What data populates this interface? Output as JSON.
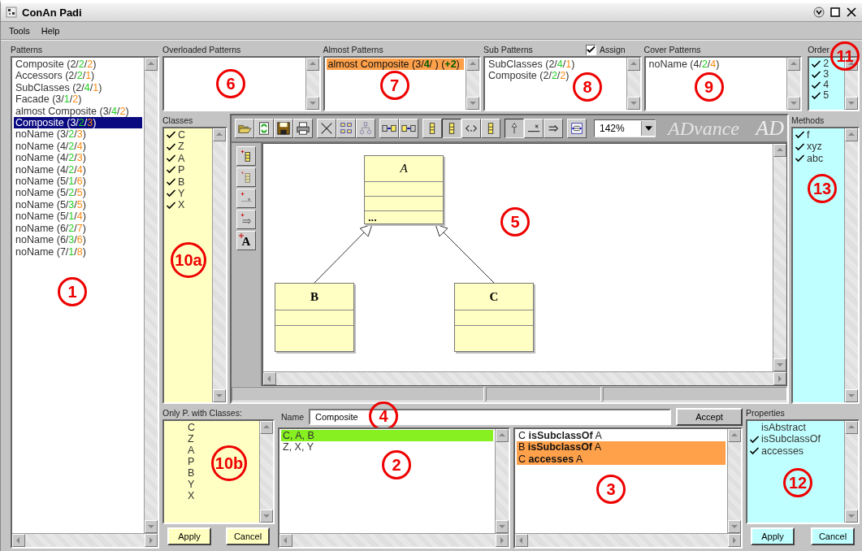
{
  "window": {
    "title": "ConAn Padi"
  },
  "menu": [
    {
      "label": "Tools"
    },
    {
      "label": "Help"
    }
  ],
  "patterns": {
    "label": "Patterns",
    "callout": "1",
    "items": [
      {
        "selected": false,
        "segments": [
          {
            "text": "Composite (2/",
            "kind": "plain"
          },
          {
            "text": "2",
            "kind": "match"
          },
          {
            "text": "/",
            "kind": "plain"
          },
          {
            "text": "2",
            "kind": "extra"
          },
          {
            "text": ")",
            "kind": "plain"
          }
        ]
      },
      {
        "selected": false,
        "segments": [
          {
            "text": "Accessors (2/",
            "kind": "plain"
          },
          {
            "text": "2",
            "kind": "match"
          },
          {
            "text": "/",
            "kind": "plain"
          },
          {
            "text": "1",
            "kind": "extra"
          },
          {
            "text": ")",
            "kind": "plain"
          }
        ]
      },
      {
        "selected": false,
        "segments": [
          {
            "text": "SubClasses (2/",
            "kind": "plain"
          },
          {
            "text": "4",
            "kind": "match"
          },
          {
            "text": "/",
            "kind": "plain"
          },
          {
            "text": "1",
            "kind": "extra"
          },
          {
            "text": ")",
            "kind": "plain"
          }
        ]
      },
      {
        "selected": false,
        "segments": [
          {
            "text": "Facade (3/",
            "kind": "plain"
          },
          {
            "text": "1",
            "kind": "match"
          },
          {
            "text": "/",
            "kind": "plain"
          },
          {
            "text": "2",
            "kind": "extra"
          },
          {
            "text": ")",
            "kind": "plain"
          }
        ]
      },
      {
        "selected": false,
        "segments": [
          {
            "text": "almost Composite (3/",
            "kind": "plain"
          },
          {
            "text": "4",
            "kind": "match"
          },
          {
            "text": "/",
            "kind": "plain"
          },
          {
            "text": "2",
            "kind": "extra"
          },
          {
            "text": ")",
            "kind": "plain"
          }
        ]
      },
      {
        "selected": true,
        "segments": [
          {
            "text": "Composite (3/",
            "kind": "plain"
          },
          {
            "text": "2",
            "kind": "match"
          },
          {
            "text": "/",
            "kind": "plain"
          },
          {
            "text": "3",
            "kind": "extra"
          },
          {
            "text": ")",
            "kind": "plain"
          }
        ]
      },
      {
        "selected": false,
        "segments": [
          {
            "text": "noName (3/",
            "kind": "plain"
          },
          {
            "text": "2",
            "kind": "match"
          },
          {
            "text": "/",
            "kind": "plain"
          },
          {
            "text": "3",
            "kind": "extra"
          },
          {
            "text": ")",
            "kind": "plain"
          }
        ]
      },
      {
        "selected": false,
        "segments": [
          {
            "text": "noName (4/",
            "kind": "plain"
          },
          {
            "text": "2",
            "kind": "match"
          },
          {
            "text": "/",
            "kind": "plain"
          },
          {
            "text": "4",
            "kind": "extra"
          },
          {
            "text": ")",
            "kind": "plain"
          }
        ]
      },
      {
        "selected": false,
        "segments": [
          {
            "text": "noName (4/",
            "kind": "plain"
          },
          {
            "text": "2",
            "kind": "match"
          },
          {
            "text": "/",
            "kind": "plain"
          },
          {
            "text": "3",
            "kind": "extra"
          },
          {
            "text": ")",
            "kind": "plain"
          }
        ]
      },
      {
        "selected": false,
        "segments": [
          {
            "text": "noName (4/",
            "kind": "plain"
          },
          {
            "text": "2",
            "kind": "match"
          },
          {
            "text": "/",
            "kind": "plain"
          },
          {
            "text": "4",
            "kind": "extra"
          },
          {
            "text": ")",
            "kind": "plain"
          }
        ]
      },
      {
        "selected": false,
        "segments": [
          {
            "text": "noName (5/",
            "kind": "plain"
          },
          {
            "text": "1",
            "kind": "match"
          },
          {
            "text": "/",
            "kind": "plain"
          },
          {
            "text": "6",
            "kind": "extra"
          },
          {
            "text": ")",
            "kind": "plain"
          }
        ]
      },
      {
        "selected": false,
        "segments": [
          {
            "text": "noName (5/",
            "kind": "plain"
          },
          {
            "text": "2",
            "kind": "match"
          },
          {
            "text": "/",
            "kind": "plain"
          },
          {
            "text": "5",
            "kind": "extra"
          },
          {
            "text": ")",
            "kind": "plain"
          }
        ]
      },
      {
        "selected": false,
        "segments": [
          {
            "text": "noName (5/",
            "kind": "plain"
          },
          {
            "text": "3",
            "kind": "match"
          },
          {
            "text": "/",
            "kind": "plain"
          },
          {
            "text": "5",
            "kind": "extra"
          },
          {
            "text": ")",
            "kind": "plain"
          }
        ]
      },
      {
        "selected": false,
        "segments": [
          {
            "text": "noName (5/",
            "kind": "plain"
          },
          {
            "text": "1",
            "kind": "match"
          },
          {
            "text": "/",
            "kind": "plain"
          },
          {
            "text": "4",
            "kind": "extra"
          },
          {
            "text": ")",
            "kind": "plain"
          }
        ]
      },
      {
        "selected": false,
        "segments": [
          {
            "text": "noName (6/",
            "kind": "plain"
          },
          {
            "text": "2",
            "kind": "match"
          },
          {
            "text": "/",
            "kind": "plain"
          },
          {
            "text": "7",
            "kind": "extra"
          },
          {
            "text": ")",
            "kind": "plain"
          }
        ]
      },
      {
        "selected": false,
        "segments": [
          {
            "text": "noName (6/",
            "kind": "plain"
          },
          {
            "text": "3",
            "kind": "match"
          },
          {
            "text": "/",
            "kind": "plain"
          },
          {
            "text": "6",
            "kind": "extra"
          },
          {
            "text": ")",
            "kind": "plain"
          }
        ]
      },
      {
        "selected": false,
        "segments": [
          {
            "text": "noName (7/",
            "kind": "plain"
          },
          {
            "text": "1",
            "kind": "match"
          },
          {
            "text": "/",
            "kind": "plain"
          },
          {
            "text": "8",
            "kind": "extra"
          },
          {
            "text": ")",
            "kind": "plain"
          }
        ]
      }
    ]
  },
  "overloaded": {
    "label": "Overloaded Patterns",
    "callout": "6"
  },
  "almost": {
    "label": "Almost Patterns",
    "callout": "7",
    "items": [
      {
        "selected": true,
        "segments": [
          {
            "text": "almost Composite (3/",
            "kind": "plain"
          },
          {
            "text": "4",
            "kind": "match"
          },
          {
            "text": "/ ) (",
            "kind": "plain"
          },
          {
            "text": "+2",
            "kind": "match"
          },
          {
            "text": ")",
            "kind": "plain"
          }
        ]
      }
    ]
  },
  "sub": {
    "label": "Sub Patterns",
    "assign": {
      "label": "Assign",
      "checked": true
    },
    "callout": "8",
    "items": [
      {
        "selected": false,
        "segments": [
          {
            "text": "SubClasses (2/",
            "kind": "plain"
          },
          {
            "text": "4",
            "kind": "match"
          },
          {
            "text": "/",
            "kind": "plain"
          },
          {
            "text": "1",
            "kind": "extra"
          },
          {
            "text": ")",
            "kind": "plain"
          }
        ]
      },
      {
        "selected": false,
        "segments": [
          {
            "text": "Composite (2/",
            "kind": "plain"
          },
          {
            "text": "2",
            "kind": "match"
          },
          {
            "text": "/",
            "kind": "plain"
          },
          {
            "text": "2",
            "kind": "extra"
          },
          {
            "text": ")",
            "kind": "plain"
          }
        ]
      }
    ]
  },
  "cover": {
    "label": "Cover Patterns",
    "callout": "9",
    "items": [
      {
        "selected": false,
        "segments": [
          {
            "text": "noName (4/",
            "kind": "plain"
          },
          {
            "text": "2",
            "kind": "match"
          },
          {
            "text": "/",
            "kind": "plain"
          },
          {
            "text": "4",
            "kind": "extra"
          },
          {
            "text": ")",
            "kind": "plain"
          }
        ]
      }
    ]
  },
  "order": {
    "label": "Order",
    "callout": "11",
    "items": [
      {
        "label": "2",
        "checked": true
      },
      {
        "label": "3",
        "checked": true
      },
      {
        "label": "4",
        "checked": true
      },
      {
        "label": "5",
        "checked": true
      }
    ]
  },
  "classes": {
    "label": "Classes",
    "callout": "10a",
    "items": [
      {
        "label": "C",
        "checked": true
      },
      {
        "label": "Z",
        "checked": true
      },
      {
        "label": "A",
        "checked": true
      },
      {
        "label": "P",
        "checked": true
      },
      {
        "label": "B",
        "checked": true
      },
      {
        "label": "Y",
        "checked": true
      },
      {
        "label": "X",
        "checked": true
      }
    ]
  },
  "editor": {
    "callout": "5",
    "zoom": "142%",
    "logo": "ADvance",
    "logo_repeat": "AD",
    "toolbar": [
      [
        {
          "kind": "open",
          "pressed": false
        },
        {
          "kind": "refresh",
          "pressed": false
        },
        {
          "kind": "save",
          "pressed": false
        },
        {
          "kind": "print",
          "pressed": false
        }
      ],
      [
        {
          "kind": "cut",
          "pressed": false
        },
        {
          "kind": "grid",
          "pressed": false
        },
        {
          "kind": "tree",
          "pressed": false
        }
      ],
      [
        {
          "kind": "move-right",
          "pressed": false
        },
        {
          "kind": "move-left",
          "pressed": false
        }
      ],
      [
        {
          "kind": "class",
          "pressed": false
        },
        {
          "kind": "class",
          "pressed": true
        },
        {
          "kind": "code",
          "pressed": false
        },
        {
          "kind": "class",
          "pressed": false
        }
      ],
      [
        {
          "kind": "inherit",
          "pressed": true
        },
        {
          "kind": "assoc",
          "pressed": false
        },
        {
          "kind": "link",
          "pressed": false
        }
      ],
      [
        {
          "kind": "fit",
          "pressed": false
        }
      ]
    ],
    "palette": [
      {
        "kind": "add-class"
      },
      {
        "kind": "add-class-faded"
      },
      {
        "kind": "add-attribute"
      },
      {
        "kind": "add-link"
      },
      {
        "kind": "add-text",
        "label": "A"
      }
    ],
    "diagram": {
      "name": "A",
      "abstract": true,
      "members": "...",
      "children": [
        {
          "name": "B",
          "abstract": false
        },
        {
          "name": "C",
          "abstract": false
        }
      ]
    }
  },
  "methods": {
    "label": "Methods",
    "callout": "13",
    "items": [
      {
        "label": "f",
        "checked": true
      },
      {
        "label": "xyz",
        "checked": true
      },
      {
        "label": "abc",
        "checked": true
      }
    ]
  },
  "only_classes": {
    "label": "Only P. with Classes:",
    "callout": "10b",
    "items": [
      {
        "label": "C",
        "checked": false
      },
      {
        "label": "Z",
        "checked": false
      },
      {
        "label": "A",
        "checked": false
      },
      {
        "label": "P",
        "checked": false
      },
      {
        "label": "B",
        "checked": false
      },
      {
        "label": "Y",
        "checked": false
      },
      {
        "label": "X",
        "checked": false
      }
    ],
    "buttons": [
      "Apply",
      "Cancel"
    ]
  },
  "name": {
    "label": "Name",
    "value": "Composite",
    "button": "Accept",
    "callout": "4"
  },
  "matches": {
    "callout": "2",
    "items": [
      {
        "text": "C, A, B",
        "selected": true
      },
      {
        "text": "Z, X, Y",
        "selected": false
      }
    ]
  },
  "relations": {
    "callout": "3",
    "items": [
      {
        "text": "C **isSubclassOf** A",
        "selected": false
      },
      {
        "text": "B **isSubclassOf** A",
        "selected": true
      },
      {
        "text": "C **accesses** A",
        "selected": true
      }
    ]
  },
  "properties": {
    "label": "Properties",
    "callout": "12",
    "items": [
      {
        "label": "isAbstract",
        "checked": false
      },
      {
        "label": "isSubclassOf",
        "checked": true
      },
      {
        "label": "accesses",
        "checked": true
      }
    ],
    "buttons": [
      "Apply",
      "Cancel"
    ]
  }
}
